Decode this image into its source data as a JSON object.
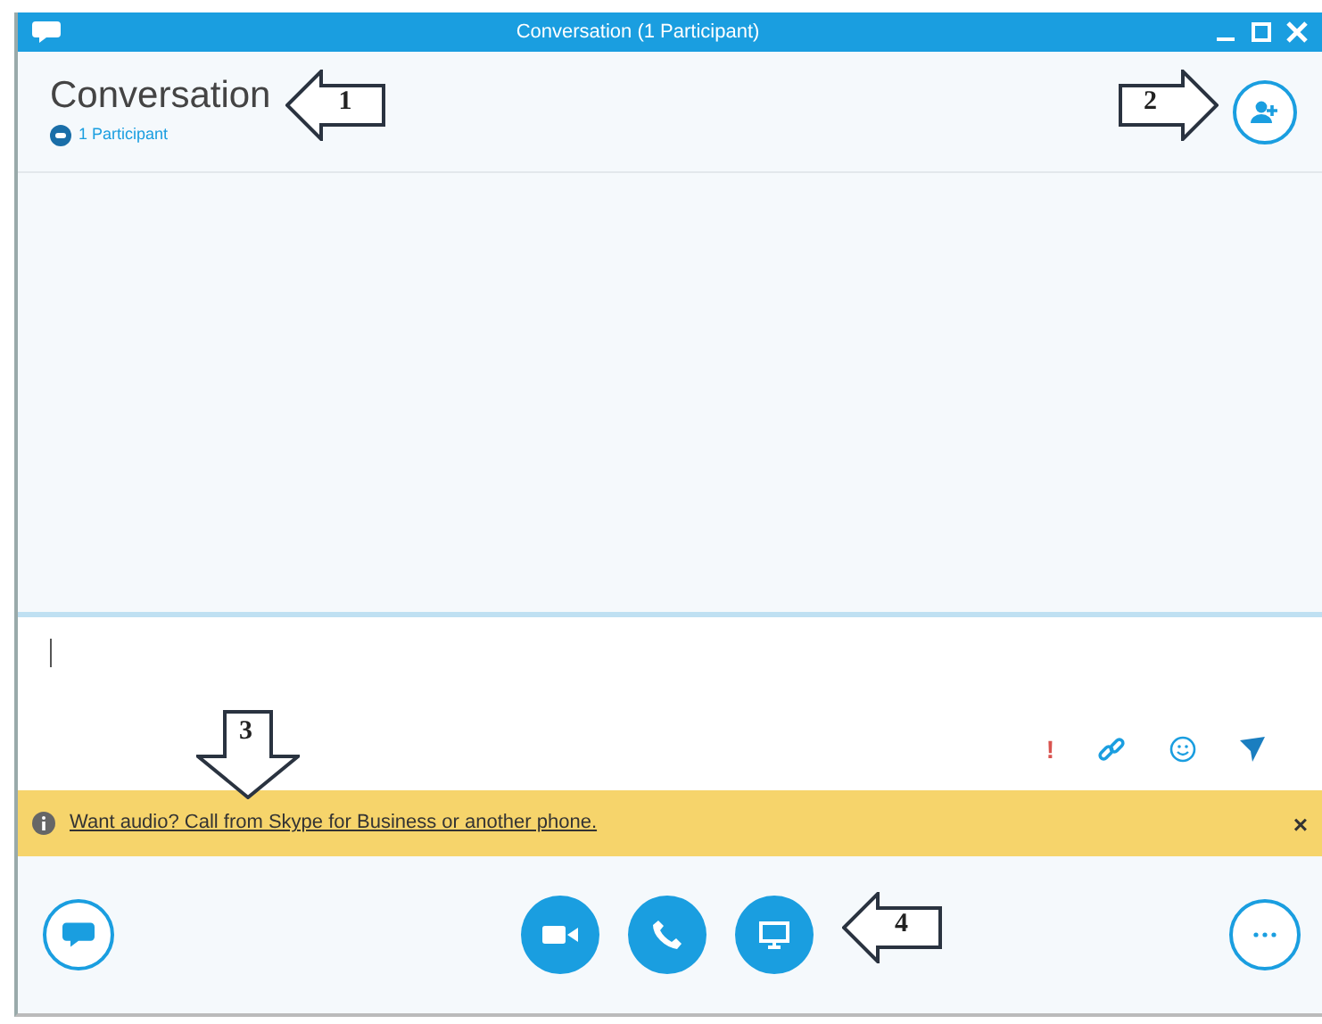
{
  "window": {
    "title": "Conversation (1 Participant)"
  },
  "header": {
    "title": "Conversation",
    "participants": "1 Participant"
  },
  "compose": {
    "importance_mark": "!"
  },
  "notice": {
    "text": "Want audio? Call from Skype for Business or another phone.",
    "close": "×"
  },
  "callouts": {
    "title": "1",
    "add_people": "2",
    "notice": "3",
    "share": "4"
  }
}
